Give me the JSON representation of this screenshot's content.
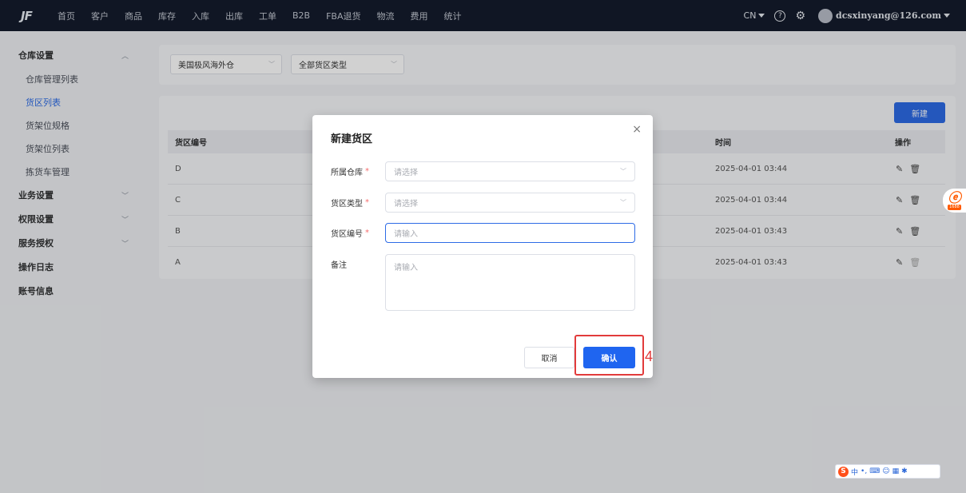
{
  "topbar": {
    "logo": "JF",
    "nav": [
      "首页",
      "客户",
      "商品",
      "库存",
      "入库",
      "出库",
      "工单",
      "B2B",
      "FBA退货",
      "物流",
      "费用",
      "统计"
    ],
    "lang": "CN",
    "help": "?",
    "user_email": "dcsxinyang@126.com"
  },
  "sidebar": {
    "groups": {
      "warehouse": "仓库设置",
      "business": "业务设置",
      "permission": "权限设置",
      "service": "服务授权",
      "oplog": "操作日志",
      "account": "账号信息"
    },
    "items": [
      "仓库管理列表",
      "货区列表",
      "货架位规格",
      "货架位列表",
      "拣货车管理"
    ]
  },
  "filters": {
    "warehouse": "美国极风海外仓",
    "zone_type": "全部货区类型"
  },
  "table": {
    "new_button": "新建",
    "columns": {
      "code": "货区编号",
      "time": "时间",
      "ops": "操作"
    },
    "rows": [
      {
        "code": "D",
        "time": "2025-04-01 03:44"
      },
      {
        "code": "C",
        "time": "2025-04-01 03:44"
      },
      {
        "code": "B",
        "time": "2025-04-01 03:43"
      },
      {
        "code": "A",
        "time": "2025-04-01 03:43"
      }
    ]
  },
  "dialog": {
    "title": "新建货区",
    "close": "×",
    "required_mark": "*",
    "fields": {
      "warehouse": {
        "label": "所属仓库",
        "placeholder": "请选择"
      },
      "zone_type": {
        "label": "货区类型",
        "placeholder": "请选择"
      },
      "zone_code": {
        "label": "货区编号",
        "placeholder": "请输入"
      },
      "remark": {
        "label": "备注",
        "placeholder": "请输入"
      }
    },
    "cancel": "取消",
    "confirm": "确认"
  },
  "annotation": {
    "step": "4"
  },
  "badge": {
    "text": "1688"
  },
  "ime": {
    "chars": [
      "中",
      "•,",
      "⌨",
      "☺",
      "▦",
      "✱"
    ]
  }
}
